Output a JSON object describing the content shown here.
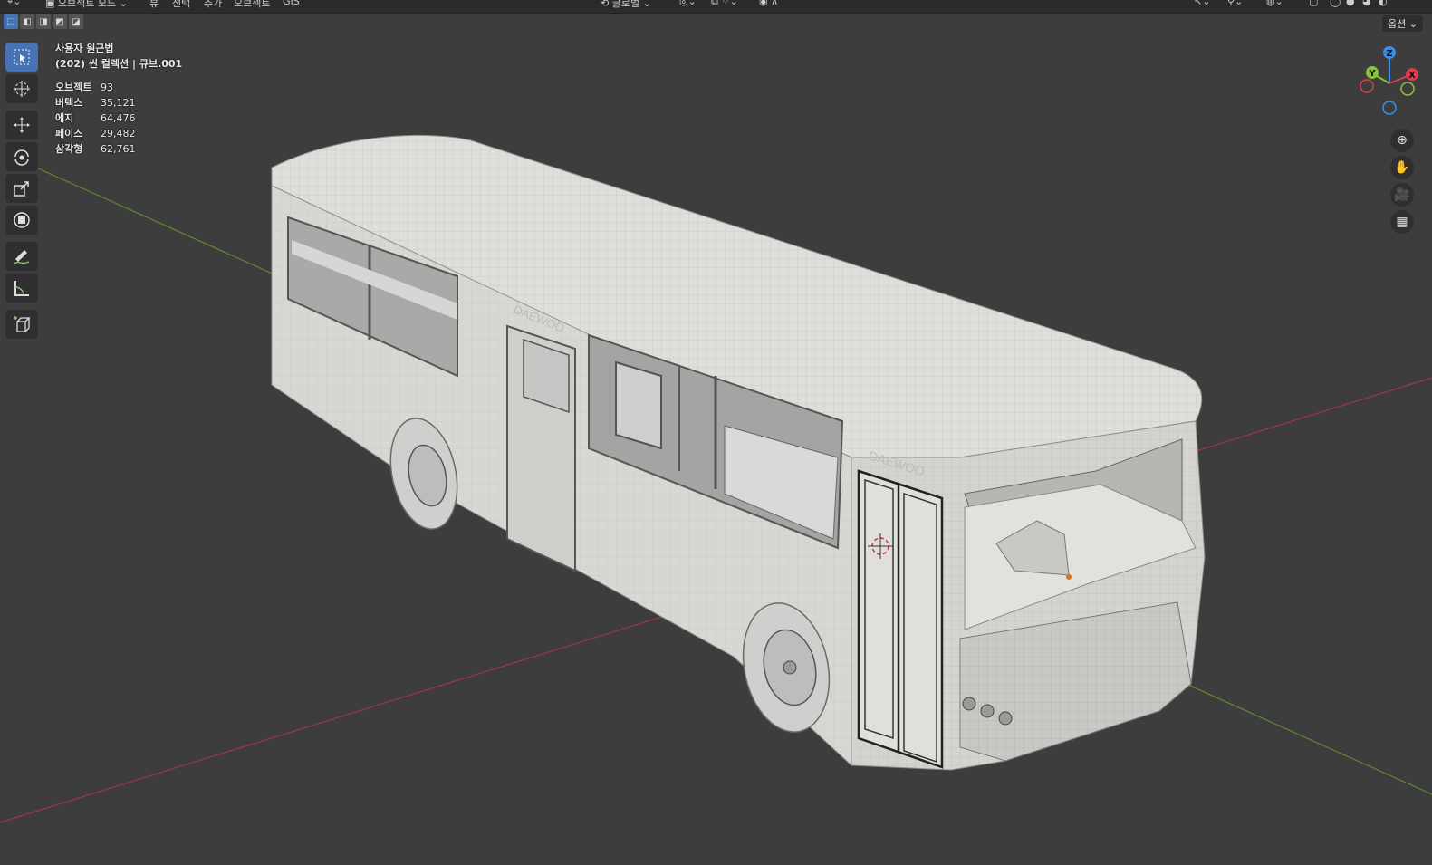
{
  "header": {
    "editor_type_icon": "transform-icon",
    "mode_label": "오브젝트 모드",
    "menus": [
      "뷰",
      "선택",
      "추가",
      "오브젝트",
      "GIS"
    ],
    "transform_orientation": "글로벌"
  },
  "select_modes": [
    "new",
    "extend",
    "subtract",
    "invert",
    "intersect"
  ],
  "options_label": "옵션",
  "viewport": {
    "view_name": "사용자 원근법",
    "collection_label": "(202) 씬 컬렉션 | 큐브.001",
    "stats": [
      {
        "label": "오브젝트",
        "value": "93"
      },
      {
        "label": "버텍스",
        "value": "35,121"
      },
      {
        "label": "에지",
        "value": "64,476"
      },
      {
        "label": "페이스",
        "value": "29,482"
      },
      {
        "label": "삼각형",
        "value": "62,761"
      }
    ]
  },
  "tools": [
    {
      "name": "select-box-tool",
      "icon": "select-box-icon",
      "active": true
    },
    {
      "name": "cursor-tool",
      "icon": "cursor-icon",
      "active": false
    },
    {
      "name": "move-tool",
      "icon": "move-icon",
      "active": false
    },
    {
      "name": "rotate-tool",
      "icon": "rotate-icon",
      "active": false
    },
    {
      "name": "scale-tool",
      "icon": "scale-icon",
      "active": false
    },
    {
      "name": "transform-tool",
      "icon": "transform-icon",
      "active": false
    },
    {
      "name": "annotate-tool",
      "icon": "annotate-icon",
      "active": false
    },
    {
      "name": "measure-tool",
      "icon": "measure-icon",
      "active": false
    },
    {
      "name": "add-cube-tool",
      "icon": "add-cube-icon",
      "active": false
    }
  ],
  "gizmo_axes": [
    "Z",
    "Y",
    "X"
  ],
  "nav_buttons": [
    "zoom-icon",
    "hand-pan-icon",
    "camera-icon",
    "perspective-grid-icon"
  ],
  "bus_brand": "DAEWOO",
  "colors": {
    "viewport_bg": "#3d3d3d",
    "x_axis": "#9b3a45",
    "y_axis": "#5f8a2e",
    "active_tool": "#4772b3",
    "gizmo_x": "#e33a4f",
    "gizmo_y": "#8ac23c",
    "gizmo_z": "#3a8ee6"
  }
}
